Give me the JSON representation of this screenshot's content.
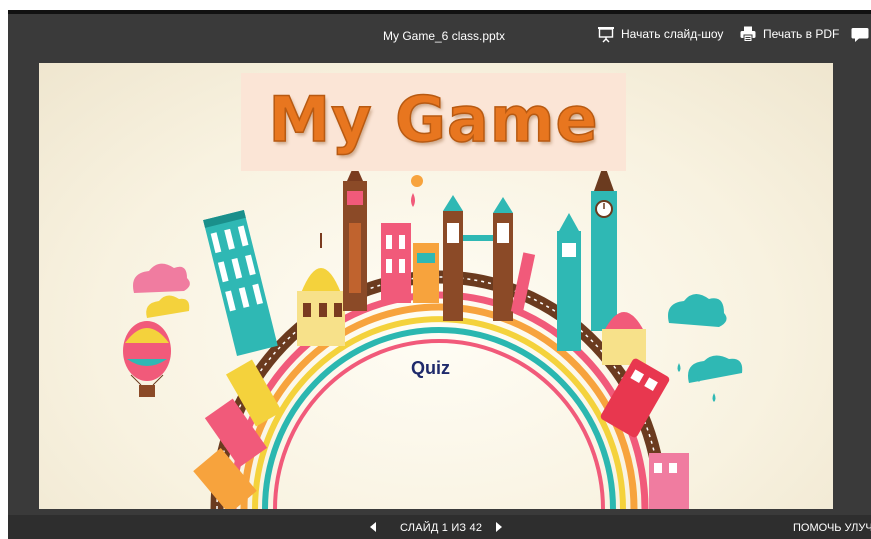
{
  "document": {
    "title": "My Game_6 class.pptx"
  },
  "toolbar": {
    "start_slideshow_label": "Начать слайд-шоу",
    "print_pdf_label": "Печать в PDF",
    "slideshow_icon": "presentation-screen-icon",
    "print_icon": "printer-icon",
    "comment_icon": "comment-icon"
  },
  "slide": {
    "title": "My Game",
    "subtitle": "Quiz",
    "title_color": "#e8761f",
    "title_bg_color": "#fbe5d6"
  },
  "footer": {
    "slide_counter": "СЛАЙД 1 ИЗ 42",
    "help_link": "ПОМОЧЬ УЛУЧШ",
    "prev_icon": "triangle-left-icon",
    "next_icon": "triangle-right-icon"
  },
  "colors": {
    "viewer_bg": "#3a3a3a",
    "bottom_bar_bg": "#2e2e2e"
  }
}
